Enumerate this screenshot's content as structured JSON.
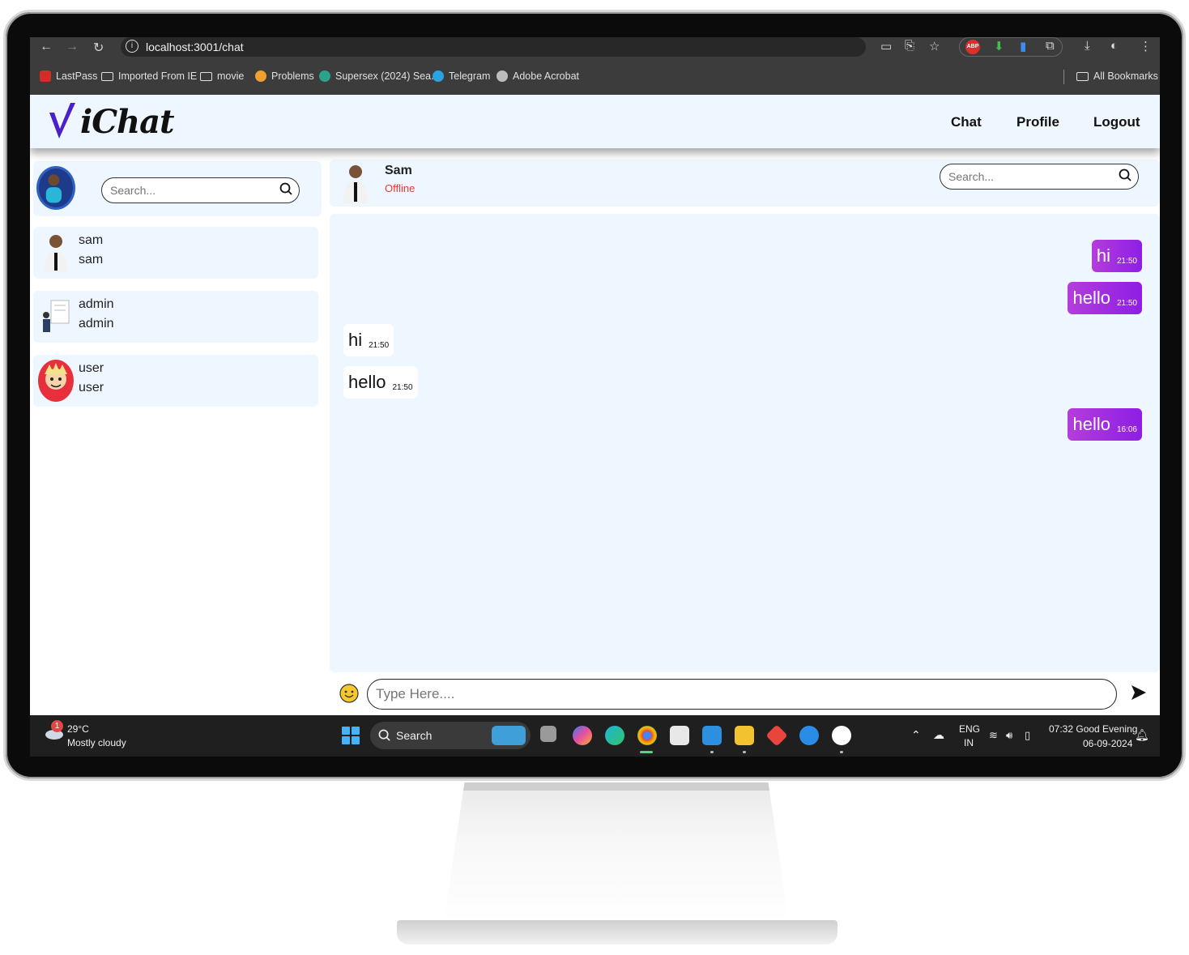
{
  "browser": {
    "url": "localhost:3001/chat",
    "bookmarks": [
      "LastPass",
      "Imported From IE",
      "movie",
      "Problems",
      "Supersex (2024) Sea...",
      "Telegram",
      "Adobe Acrobat"
    ],
    "all_bookmarks": "All Bookmarks",
    "abp_label": "ABP"
  },
  "app": {
    "logo": "iChat",
    "nav": {
      "chat": "Chat",
      "profile": "Profile",
      "logout": "Logout"
    },
    "sidebar_search_placeholder": "Search...",
    "chat_search_placeholder": "Search...",
    "contacts": [
      {
        "name": "sam",
        "sub": "sam"
      },
      {
        "name": "admin",
        "sub": "admin"
      },
      {
        "name": "user",
        "sub": "user"
      }
    ],
    "active_chat": {
      "name": "Sam",
      "status": "Offline"
    },
    "messages": [
      {
        "dir": "out",
        "text": "hi",
        "time": "21:50"
      },
      {
        "dir": "out",
        "text": "hello",
        "time": "21:50"
      },
      {
        "dir": "in",
        "text": "hi",
        "time": "21:50"
      },
      {
        "dir": "in",
        "text": "hello",
        "time": "21:50"
      },
      {
        "dir": "out",
        "text": "hello",
        "time": "16:06"
      }
    ],
    "compose_placeholder": "Type Here...."
  },
  "taskbar": {
    "weather_badge": "1",
    "temp": "29°C",
    "condition": "Mostly cloudy",
    "search_label": "Search",
    "lang_top": "ENG",
    "lang_bottom": "IN",
    "time_line": "07:32 Good Evening",
    "date": "06-09-2024"
  },
  "colors": {
    "app_bg": "#eef6ff",
    "outgoing_bubble": "#9b27e0",
    "status_offline": "#e23d2c",
    "logo_v": "#4b1fc9"
  }
}
